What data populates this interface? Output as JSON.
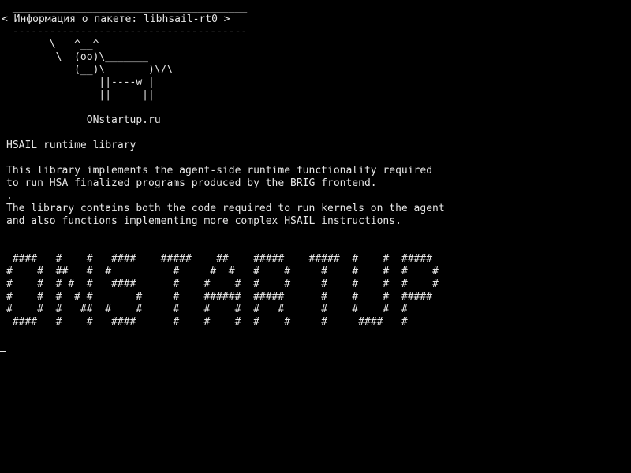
{
  "cowsay": {
    "border_top": " ______________________________________",
    "message": "< Информация о пакете: libhsail-rt0 >",
    "border_bottom": " --------------------------------------",
    "cow_lines": [
      "       \\   ^__^",
      "        \\  (oo)\\_______",
      "           (__)\\       )\\/\\",
      "               ||----w |",
      "               ||     ||"
    ],
    "site": "             ONstartup.ru"
  },
  "description": {
    "title": "HSAIL runtime library",
    "paragraph1_line1": "This library implements the agent-side runtime functionality required",
    "paragraph1_line2": "to run HSA finalized programs produced by the BRIG frontend.",
    "separator_dot": ".",
    "paragraph2_line1": "The library contains both the code required to run kernels on the agent",
    "paragraph2_line2": "and also functions implementing more complex HSAIL instructions."
  },
  "banner": {
    "lines": [
      " ####   #    #   ####    #####    ##    #####    #####  #    #  #####",
      "#    #  ##   #  #          #     #  #   #    #     #    #    #  #    #",
      "#    #  # #  #   ####      #    #    #  #    #     #    #    #  #    #",
      "#    #  #  # #       #     #    ######  #####      #    #    #  #####",
      "#    #  #   ##  #    #     #    #    #  #   #      #    #    #  #",
      " ####   #    #   ####      #    #    #  #    #     #     ####   #"
    ]
  },
  "cursor": {
    "symbol": "_"
  }
}
